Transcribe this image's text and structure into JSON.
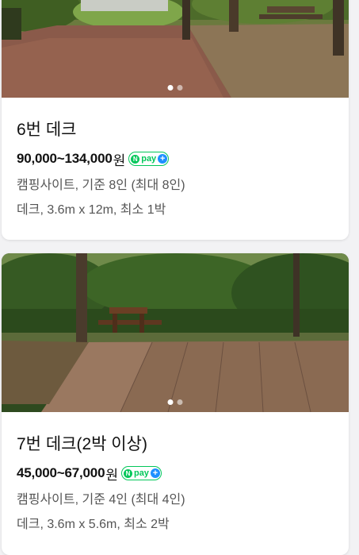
{
  "listings": [
    {
      "title": "6번 데크",
      "price": "90,000~134,000",
      "currency": "원",
      "npay": {
        "n": "N",
        "label": "pay",
        "plus": "+"
      },
      "capacity": "캠핑사이트, 기준 8인 (최대 8인)",
      "spec": "데크, 3.6m x 12m, 최소 1박",
      "slide_count": 2,
      "active_slide": 1
    },
    {
      "title": "7번 데크(2박 이상)",
      "price": "45,000~67,000",
      "currency": "원",
      "npay": {
        "n": "N",
        "label": "pay",
        "plus": "+"
      },
      "capacity": "캠핑사이트, 기준 4인 (최대 4인)",
      "spec": "데크, 3.6m x 5.6m, 최소 2박",
      "slide_count": 2,
      "active_slide": 1
    }
  ],
  "colors": {
    "npay_green": "#03c75a",
    "npay_plus_blue": "#1e90ff",
    "text_primary": "#111111",
    "text_secondary": "#555555"
  }
}
